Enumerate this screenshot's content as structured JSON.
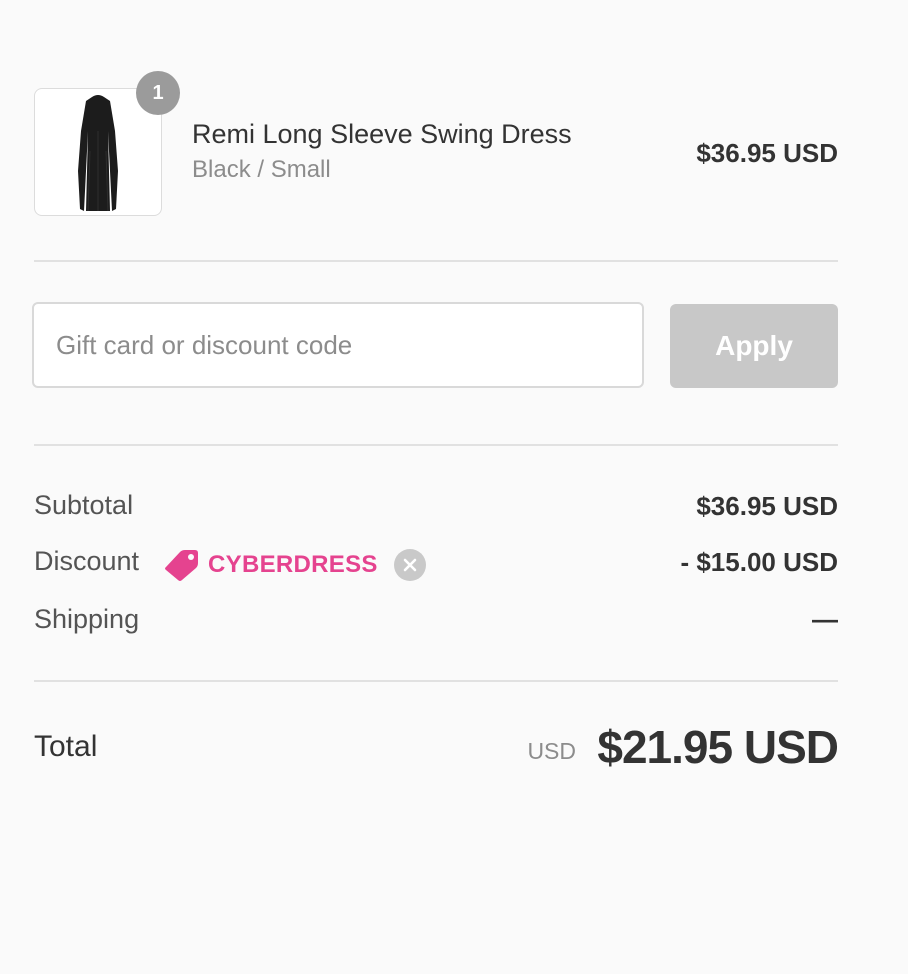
{
  "product": {
    "quantity": "1",
    "name": "Remi Long Sleeve Swing Dress",
    "variant": "Black / Small",
    "price": "$36.95 USD",
    "image_icon": "dress-thumbnail"
  },
  "discount_form": {
    "placeholder": "Gift card or discount code",
    "value": "",
    "apply_label": "Apply"
  },
  "summary": {
    "subtotal_label": "Subtotal",
    "subtotal_value": "$36.95 USD",
    "discount_label": "Discount",
    "discount_code": "CYBERDRESS",
    "discount_value": "- $15.00 USD",
    "shipping_label": "Shipping",
    "shipping_value": "—",
    "total_label": "Total",
    "total_currency": "USD",
    "total_value": "$21.95 USD"
  },
  "colors": {
    "accent": "#e5438f",
    "apply_disabled": "#c8c8c8",
    "badge": "#9b9b9b",
    "background": "#fafafa"
  },
  "icons": {
    "tag": "tag-icon",
    "remove": "close-circle-icon"
  }
}
